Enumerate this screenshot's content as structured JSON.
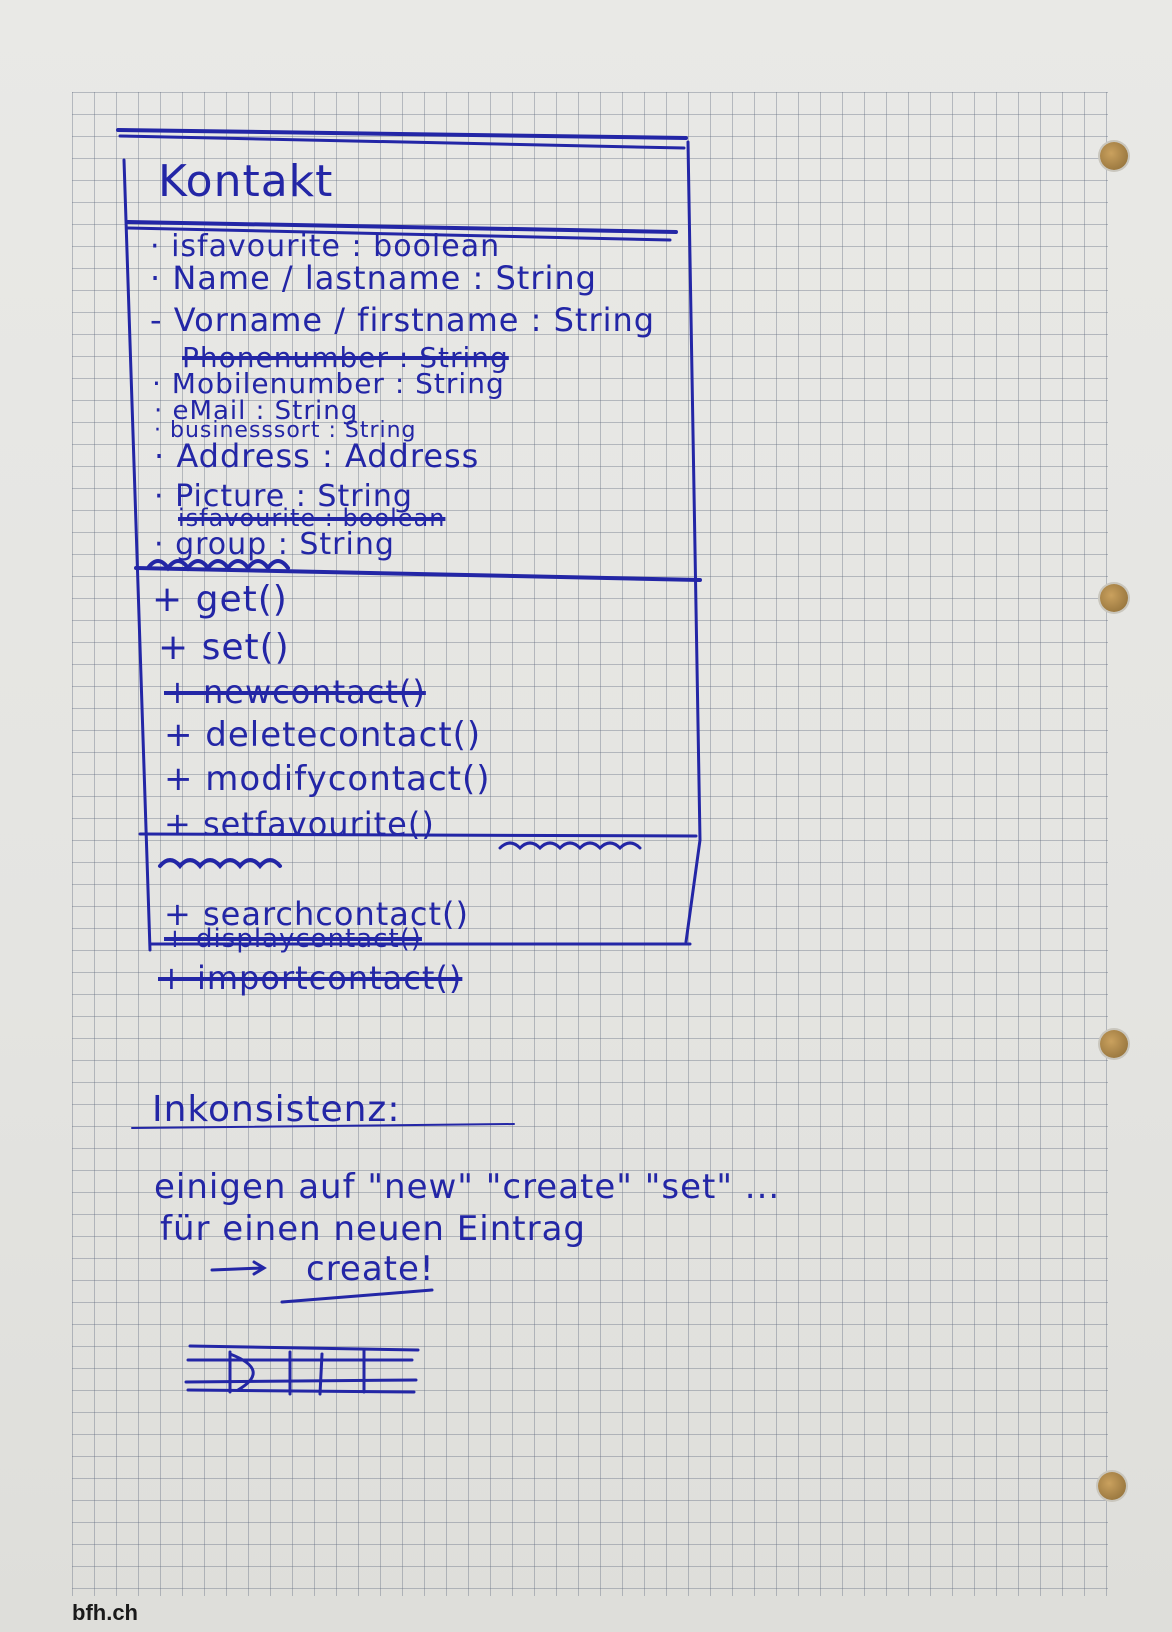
{
  "diagram": {
    "class_name": "Kontakt",
    "attributes": [
      {
        "text": "· isfavourite : boolean",
        "struck": false
      },
      {
        "text": "· Name / lastname : String",
        "struck": false
      },
      {
        "text": "- Vorname / firstname : String",
        "struck": false
      },
      {
        "text": "Phonenumber : String",
        "struck": true
      },
      {
        "text": "· Mobilenumber : String",
        "struck": false
      },
      {
        "text": "· eMail : String",
        "struck": false
      },
      {
        "text": "· businesssort : String",
        "struck": false
      },
      {
        "text": "· Address : Address",
        "struck": false
      },
      {
        "text": "· Picture : String",
        "struck": false
      },
      {
        "text": "isfavourite : boolean",
        "struck": true
      },
      {
        "text": "· group : String",
        "struck": false
      }
    ],
    "methods": [
      {
        "text": "+ get()",
        "struck": false
      },
      {
        "text": "+ set()",
        "struck": false
      },
      {
        "text": "+ newcontact()",
        "struck": true
      },
      {
        "text": "+ deletecontact()",
        "struck": false
      },
      {
        "text": "+ modifycontact()",
        "struck": false
      },
      {
        "text": "+ setfavourite()",
        "struck": false
      },
      {
        "text": "+ searchcontact()",
        "struck": false
      },
      {
        "text": "+ displaycontact()",
        "struck": true
      },
      {
        "text": "+ importcontact()",
        "struck": true
      }
    ]
  },
  "notes": {
    "heading": "Inkonsistenz:",
    "line1": "einigen auf \"new\" \"create\" \"set\" ...",
    "line2": "für einen neuen Eintrag",
    "line3": "create!"
  },
  "footer": {
    "brand": "bfh.ch"
  },
  "colors": {
    "ink": "#2326a6",
    "paper": "#e7e7e4",
    "grid": "#5f697d"
  }
}
